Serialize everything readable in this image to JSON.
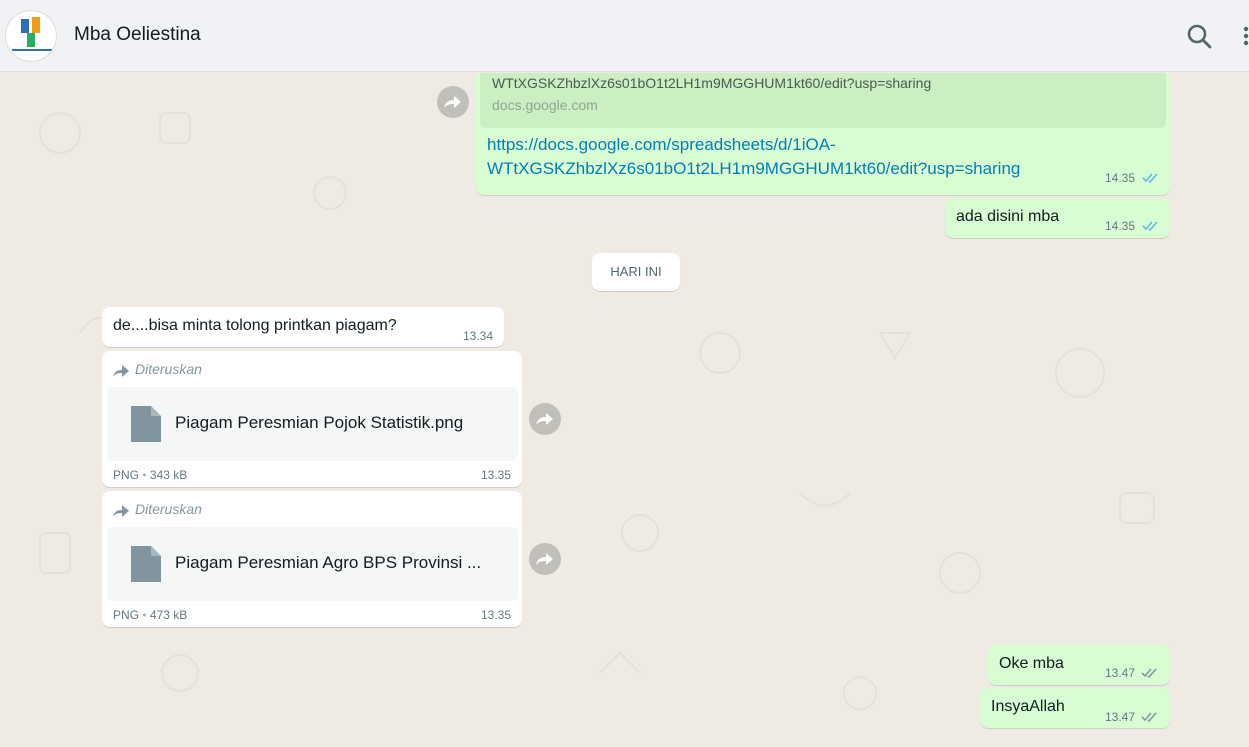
{
  "header": {
    "contact_name": "Mba Oeliestina",
    "avatar_text": "BADAN PUSAT STATISTIK",
    "search_icon": "search-icon",
    "menu_icon": "more-vertical-icon"
  },
  "date_chip": "HARI INI",
  "messages": {
    "link_msg": {
      "preview_text": "WTtXGSKZhbzlXz6s01bO1t2LH1m9MGGHUM1kt60/edit?usp=sharing",
      "preview_domain": "docs.google.com",
      "link_line1": "https://docs.google.com/spreadsheets/d/1iOA-",
      "link_line2": "WTtXGSKZhbzlXz6s01bO1t2LH1m9MGGHUM1kt60/edit?usp=sharing",
      "time": "14.35"
    },
    "ada_disini": {
      "text": "ada disini mba",
      "time": "14.35"
    },
    "request": {
      "text": "de....bisa minta tolong printkan piagam?",
      "time": "13.34"
    },
    "file1": {
      "forwarded_label": "Diteruskan",
      "file_name": "Piagam Peresmian Pojok Statistik.png",
      "type": "PNG",
      "size": "343 kB",
      "time": "13.35"
    },
    "file2": {
      "forwarded_label": "Diteruskan",
      "file_name": "Piagam Peresmian Agro BPS Provinsi ...",
      "type": "PNG",
      "size": "473 kB",
      "time": "13.35"
    },
    "oke": {
      "text": "Oke mba",
      "time": "13.47"
    },
    "insya": {
      "text": "InsyaAllah",
      "time": "13.47"
    }
  },
  "meta_separator": "•",
  "colors": {
    "outgoing": "#d9fdd3",
    "incoming": "#ffffff",
    "link": "#027eb5",
    "tick_read": "#53bdeb"
  }
}
